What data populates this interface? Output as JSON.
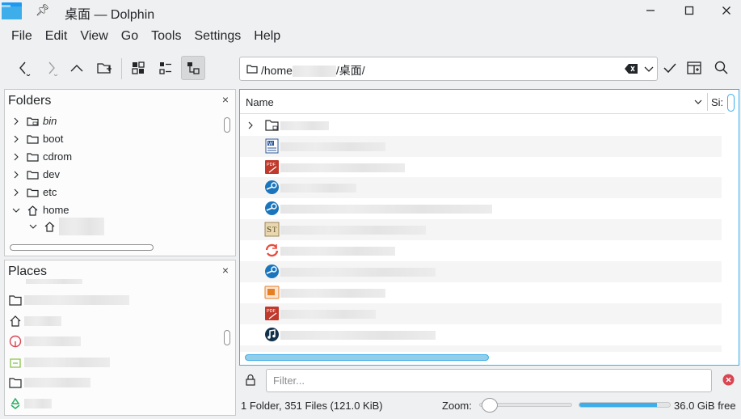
{
  "window": {
    "title": "桌面 — Dolphin",
    "minimize_glyph": "🗕",
    "maximize_glyph": "🗖",
    "close_glyph": "✕"
  },
  "menu": [
    "File",
    "Edit",
    "View",
    "Go",
    "Tools",
    "Settings",
    "Help"
  ],
  "location": {
    "path_prefix": "/home",
    "path_suffix": "/桌面/"
  },
  "folders_panel": {
    "title": "Folders",
    "close_glyph": "×",
    "items": [
      {
        "label": "bin",
        "italic": true,
        "icon": "folder-link-icon"
      },
      {
        "label": "boot",
        "icon": "folder-icon"
      },
      {
        "label": "cdrom",
        "icon": "folder-icon"
      },
      {
        "label": "dev",
        "icon": "folder-icon"
      },
      {
        "label": "etc",
        "icon": "folder-icon"
      },
      {
        "label": "home",
        "icon": "home-icon",
        "expanded": true
      }
    ]
  },
  "places_panel": {
    "title": "Places",
    "close_glyph": "×"
  },
  "main_view": {
    "column_name": "Name",
    "column_size": "Si:"
  },
  "filter": {
    "placeholder": "Filter..."
  },
  "status": {
    "summary": "1 Folder, 351 Files (121.0 KiB)",
    "zoom_label": "Zoom:",
    "zoom_level": 0.03,
    "disk_used_fraction": 0.86,
    "disk_free": "36.0 GiB free"
  },
  "colors": {
    "accent": "#3daee9",
    "window_bg": "#eff0f1",
    "view_bg": "#ffffff"
  }
}
